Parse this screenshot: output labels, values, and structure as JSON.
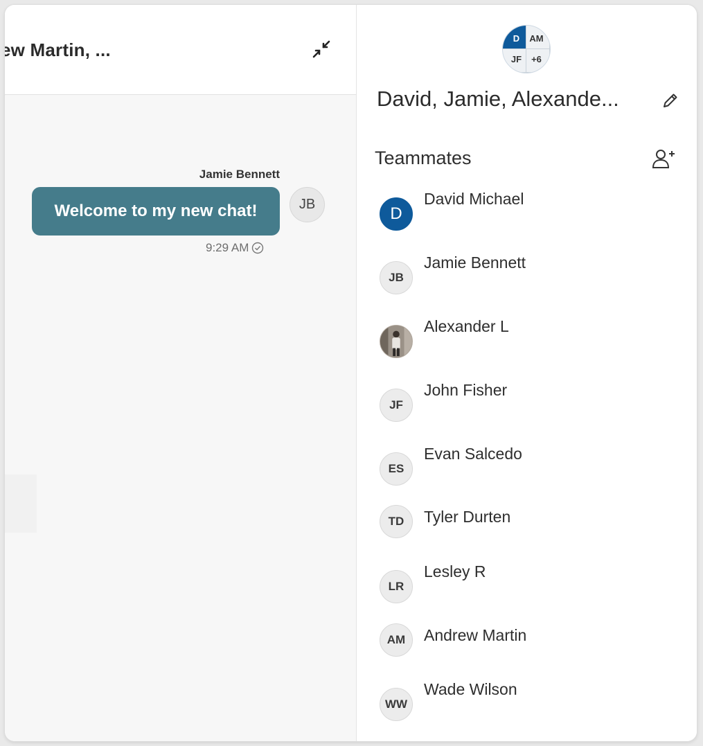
{
  "chat": {
    "title": "ew Martin, ...",
    "collapse_icon": "minimize-icon",
    "message": {
      "sender": "Jamie Bennett",
      "text": "Welcome to my new chat!",
      "avatar_initials": "JB",
      "time": "9:29 AM",
      "status_icon": "check-circle-icon"
    }
  },
  "details": {
    "group_avatar": {
      "tl": "D",
      "tr": "AM",
      "bl": "JF",
      "br": "+6"
    },
    "group_name": "David, Jamie, Alexande...",
    "edit_icon": "pencil-icon",
    "section_title": "Teammates",
    "add_icon": "add-person-icon",
    "members": [
      {
        "name": "David Michael",
        "initials": "D",
        "style": "blue"
      },
      {
        "name": "Jamie Bennett",
        "initials": "JB",
        "style": "default"
      },
      {
        "name": "Alexander L",
        "initials": "",
        "style": "photo"
      },
      {
        "name": "John Fisher",
        "initials": "JF",
        "style": "default"
      },
      {
        "name": "Evan Salcedo",
        "initials": "ES",
        "style": "default"
      },
      {
        "name": "Tyler Durten",
        "initials": "TD",
        "style": "default"
      },
      {
        "name": "Lesley R",
        "initials": "LR",
        "style": "default"
      },
      {
        "name": "Andrew Martin",
        "initials": "AM",
        "style": "default"
      },
      {
        "name": "Wade Wilson",
        "initials": "WW",
        "style": "default"
      }
    ],
    "colors": {
      "accent": "#0e5a9b",
      "bubble": "#457c8b"
    }
  }
}
